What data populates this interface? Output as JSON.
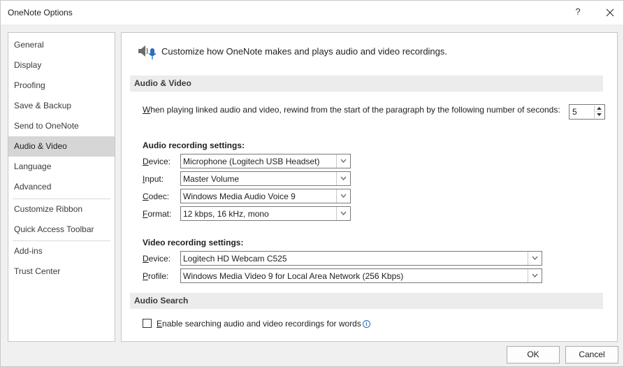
{
  "window": {
    "title": "OneNote Options",
    "help_label": "?",
    "close_label": "✕"
  },
  "sidebar": {
    "items": [
      {
        "label": "General"
      },
      {
        "label": "Display"
      },
      {
        "label": "Proofing"
      },
      {
        "label": "Save & Backup"
      },
      {
        "label": "Send to OneNote"
      },
      {
        "label": "Audio & Video",
        "selected": true
      },
      {
        "label": "Language"
      },
      {
        "label": "Advanced"
      },
      {
        "label": "Customize Ribbon"
      },
      {
        "label": "Quick Access Toolbar"
      },
      {
        "label": "Add-ins"
      },
      {
        "label": "Trust Center"
      }
    ]
  },
  "main": {
    "header_icon": "speaker-microphone-icon",
    "header_text": "Customize how OneNote makes and plays audio and video recordings.",
    "audio_video_section": {
      "title": "Audio & Video",
      "rewind_access_key": "W",
      "rewind_text_rest": "hen playing linked audio and video, rewind from the start of the paragraph by the following number of seconds:",
      "rewind_value": "5"
    },
    "audio_recording": {
      "heading": "Audio recording settings:",
      "device": {
        "label_key": "D",
        "label_rest": "evice:",
        "value": "Microphone (Logitech USB Headset)"
      },
      "input": {
        "label_key": "I",
        "label_rest": "nput:",
        "value": "Master Volume"
      },
      "codec": {
        "label_key": "C",
        "label_rest": "odec:",
        "value": "Windows Media Audio Voice 9"
      },
      "format": {
        "label_key": "F",
        "label_rest": "ormat:",
        "value": "12 kbps, 16 kHz, mono"
      }
    },
    "video_recording": {
      "heading": "Video recording settings:",
      "device": {
        "label_key": "D",
        "label_rest": "evice:",
        "value": "Logitech HD Webcam C525"
      },
      "profile": {
        "label_key": "P",
        "label_rest": "rofile:",
        "value": "Windows Media Video 9 for Local Area Network (256 Kbps)"
      }
    },
    "audio_search_section": {
      "title": "Audio Search",
      "checkbox_key": "E",
      "checkbox_label_rest": "nable searching audio and video recordings for words",
      "checked": false,
      "info_icon": "info-icon"
    }
  },
  "footer": {
    "ok_label": "OK",
    "cancel_label": "Cancel"
  },
  "colors": {
    "selected_nav": "#d6d6d6",
    "section_bar": "#ececec",
    "info_blue": "#2b6cc4"
  }
}
